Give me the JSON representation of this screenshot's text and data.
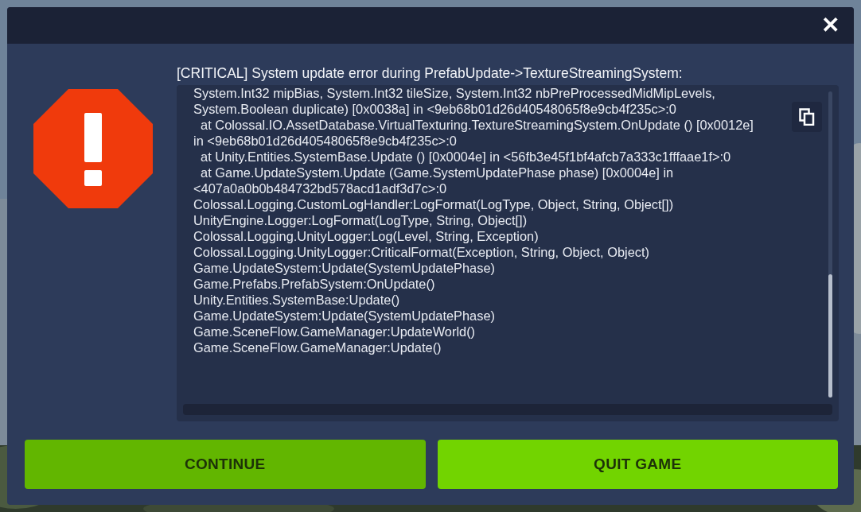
{
  "dialog": {
    "close": "✕",
    "message": "[CRITICAL] System update error during PrefabUpdate->TextureStreamingSystem:",
    "log_lines": [
      "System.Int32 mipBias, System.Int32 tileSize, System.Int32 nbPreProcessedMidMipLevels,",
      "System.Boolean duplicate) [0x0038a] in <9eb68b01d26d40548065f8e9cb4f235c>:0",
      "  at Colossal.IO.AssetDatabase.VirtualTexturing.TextureStreamingSystem.OnUpdate () [0x0012e]",
      "in <9eb68b01d26d40548065f8e9cb4f235c>:0",
      "  at Unity.Entities.SystemBase.Update () [0x0004e] in <56fb3e45f1bf4afcb7a333c1fffaae1f>:0",
      "  at Game.UpdateSystem.Update (Game.SystemUpdatePhase phase) [0x0004e] in",
      "<407a0a0b0b484732bd578acd1adf3d7c>:0",
      "Colossal.Logging.CustomLogHandler:LogFormat(LogType, Object, String, Object[])",
      "UnityEngine.Logger:LogFormat(LogType, String, Object[])",
      "Colossal.Logging.UnityLogger:Log(Level, String, Exception)",
      "Colossal.Logging.UnityLogger:CriticalFormat(Exception, String, Object, Object)",
      "Game.UpdateSystem:Update(SystemUpdatePhase)",
      "Game.Prefabs.PrefabSystem:OnUpdate()",
      "Unity.Entities.SystemBase:Update()",
      "Game.UpdateSystem:Update(SystemUpdatePhase)",
      "Game.SceneFlow.GameManager:UpdateWorld()",
      "Game.SceneFlow.GameManager:Update()"
    ],
    "buttons": [
      {
        "label": "CONTINUE",
        "selected": false
      },
      {
        "label": "QUIT GAME",
        "selected": true
      }
    ]
  }
}
